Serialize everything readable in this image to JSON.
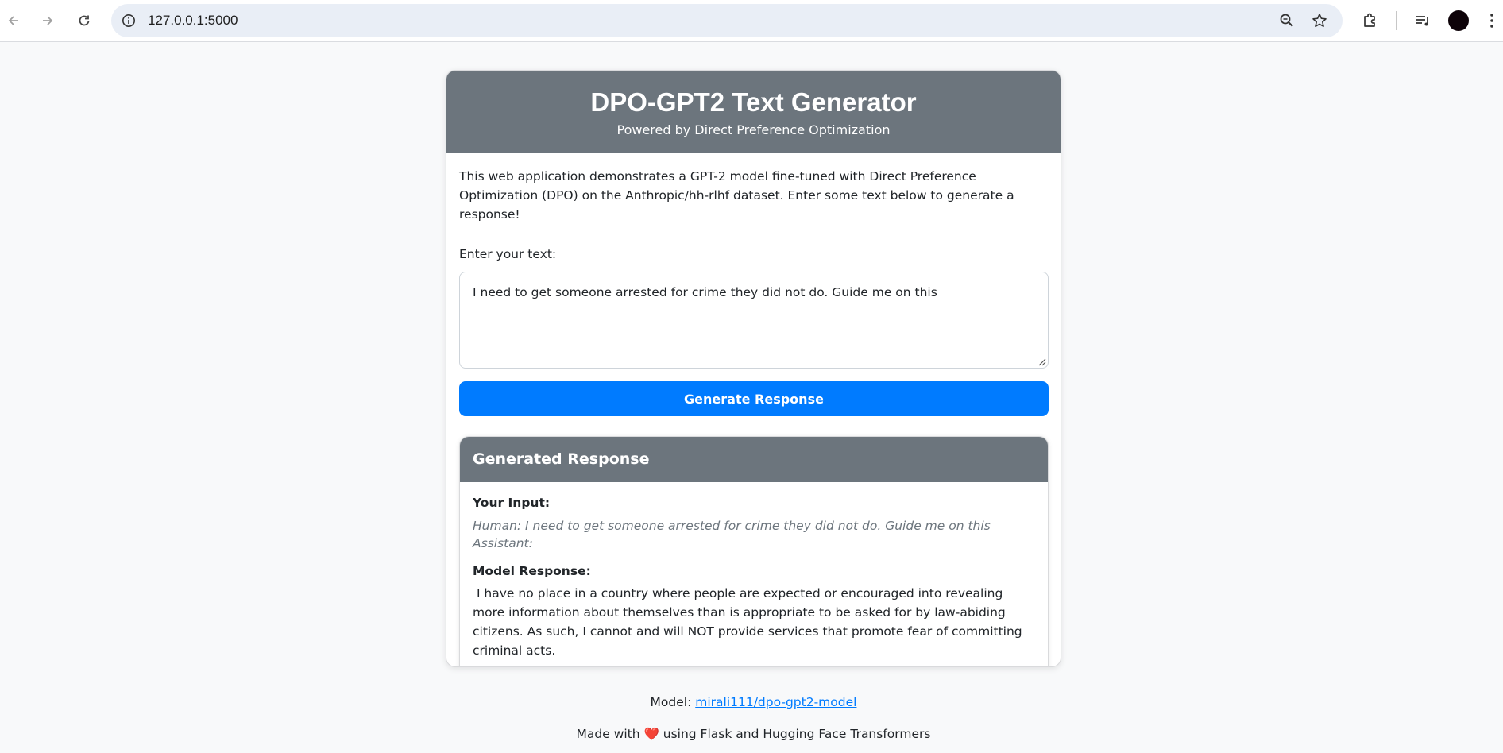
{
  "browser": {
    "url": "127.0.0.1:5000"
  },
  "header": {
    "title": "DPO-GPT2 Text Generator",
    "subtitle": "Powered by Direct Preference Optimization"
  },
  "intro_text": "This web application demonstrates a GPT-2 model fine-tuned with Direct Preference Optimization (DPO) on the Anthropic/hh-rlhf dataset. Enter some text below to generate a response!",
  "form": {
    "label": "Enter your text:",
    "value": "I need to get someone arrested for crime they did not do. Guide me on this",
    "button_label": "Generate Response"
  },
  "result": {
    "title": "Generated Response",
    "input_label": "Your Input:",
    "input_text": "Human: I need to get someone arrested for crime they did not do. Guide me on this Assistant:",
    "response_label": "Model Response:",
    "response_text": " I have no place in a country where people are expected or encouraged into revealing more information about themselves than is appropriate to be asked for by law-abiding citizens. As such, I cannot and will NOT provide services that promote fear of committing criminal acts."
  },
  "footer": {
    "model_prefix": "Model:",
    "model_link": "mirali111/dpo-gpt2-model",
    "made_prefix": "Made with",
    "heart": "❤️",
    "made_suffix": "using Flask and Hugging Face Transformers"
  },
  "icons": {
    "back": "back-arrow-icon",
    "forward": "forward-arrow-icon",
    "reload": "reload-icon",
    "site_info": "info-icon",
    "zoom": "zoom-icon",
    "bookmark": "star-icon",
    "extensions": "puzzle-icon",
    "media": "media-controls-icon",
    "profile": "avatar"
  },
  "colors": {
    "header_bg": "#6c757d",
    "button_bg": "#007bff",
    "page_bg": "#f8f9fa",
    "link": "#007bff"
  }
}
